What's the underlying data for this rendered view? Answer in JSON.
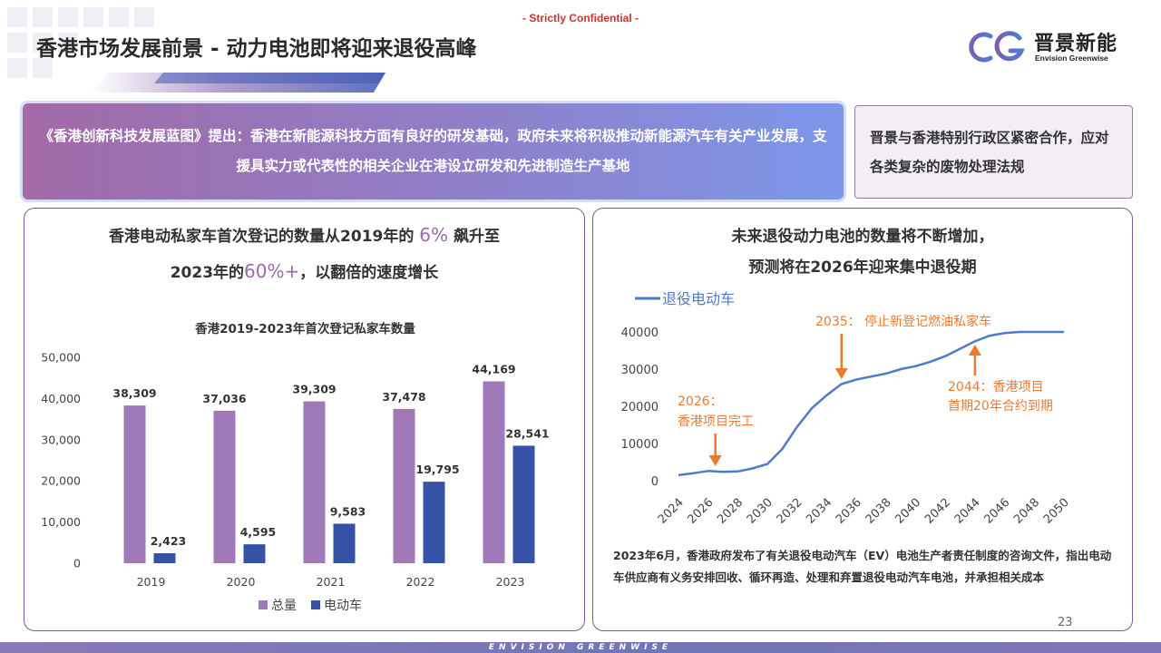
{
  "header": {
    "confidential": "- Strictly Confidential -",
    "title": "香港市场发展前景 - 动力电池即将迎来退役高峰",
    "logo_cn": "晋景新能",
    "logo_en": "Envision Greenwise"
  },
  "banner": {
    "text": "《香港创新科技发展蓝图》提出：香港在新能源科技方面有良好的研发基础，政府未来将积极推动新能源汽车有关产业发展，支援具实力或代表性的相关企业在港设立研发和先进制造生产基地"
  },
  "sidebox": {
    "text": "晋景与香港特别行政区紧密合作，应对各类复杂的废物处理法规"
  },
  "left_panel": {
    "headline_1a": "香港电动私家车首次登记的数量从2019年的",
    "headline_1b": "6%",
    "headline_1c": "飙升至",
    "headline_2a": "2023年的",
    "headline_2b": "60%+",
    "headline_2c": "，以翻倍的速度增长"
  },
  "right_panel": {
    "headline_1": "未来退役动力电池的数量将不断增加，",
    "headline_2": "预测将在2026年迎来集中退役期",
    "footnote": "2023年6月，香港政府发布了有关退役电动汽车（EV）电池生产者责任制度的咨询文件，指出电动车供应商有义务安排回收、循环再造、处理和弃置退役电动汽车电池，并承担相关成本"
  },
  "footer": {
    "page_number": "23",
    "brand": "ENVISION  GREENWISE"
  },
  "colors": {
    "total": "#a07ab8",
    "ev": "#3552a6",
    "line": "#4e7bc9",
    "annotation": "#ec7a2e"
  },
  "chart_data": [
    {
      "type": "bar",
      "title": "香港2019-2023年首次登记私家车数量",
      "categories": [
        "2019",
        "2020",
        "2021",
        "2022",
        "2023"
      ],
      "series": [
        {
          "name": "总量",
          "values": [
            38309,
            37036,
            39309,
            37478,
            44169
          ]
        },
        {
          "name": "电动车",
          "values": [
            2423,
            4595,
            9583,
            19795,
            28541
          ]
        }
      ],
      "value_labels": {
        "total": [
          "38,309",
          "37,036",
          "39,309",
          "37,478",
          "44,169"
        ],
        "ev": [
          "2,423",
          "4,595",
          "9,583",
          "19,795",
          "28,541"
        ]
      },
      "yticks": [
        "0",
        "10,000",
        "20,000",
        "30,000",
        "40,000",
        "50,000"
      ],
      "ylim": [
        0,
        50000
      ],
      "grid": false,
      "legend": "bottom"
    },
    {
      "type": "line",
      "series": [
        {
          "name": "退役电动车",
          "x": [
            2024,
            2025,
            2026,
            2027,
            2028,
            2029,
            2030,
            2031,
            2032,
            2033,
            2034,
            2035,
            2036,
            2037,
            2038,
            2039,
            2040,
            2041,
            2042,
            2043,
            2044,
            2045,
            2046,
            2047,
            2048,
            2049,
            2050
          ],
          "y": [
            1500,
            2000,
            2600,
            2400,
            2500,
            3300,
            4500,
            8500,
            14500,
            19500,
            23000,
            26000,
            27200,
            28000,
            28800,
            30000,
            30800,
            32000,
            33500,
            35500,
            37500,
            39000,
            39700,
            40000,
            40000,
            40000,
            40000
          ]
        }
      ],
      "xticks": [
        "2024",
        "2026",
        "2028",
        "2030",
        "2032",
        "2034",
        "2036",
        "2038",
        "2040",
        "2042",
        "2044",
        "2046",
        "2048",
        "2050"
      ],
      "yticks": [
        "0",
        "10000",
        "20000",
        "30000",
        "40000"
      ],
      "ylim": [
        0,
        40000
      ],
      "xlim": [
        2024,
        2050
      ],
      "grid": false,
      "legend": "top-left",
      "annotations": [
        {
          "x": 2026,
          "y": 2600,
          "line1": "2026：",
          "line2": "香港项目完工"
        },
        {
          "x": 2035,
          "y": 26000,
          "line1": "2035： 停止新登记燃油私家车",
          "line2": ""
        },
        {
          "x": 2044,
          "y": 37500,
          "line1": "2044：香港项目",
          "line2": "首期20年合约到期"
        }
      ]
    }
  ]
}
